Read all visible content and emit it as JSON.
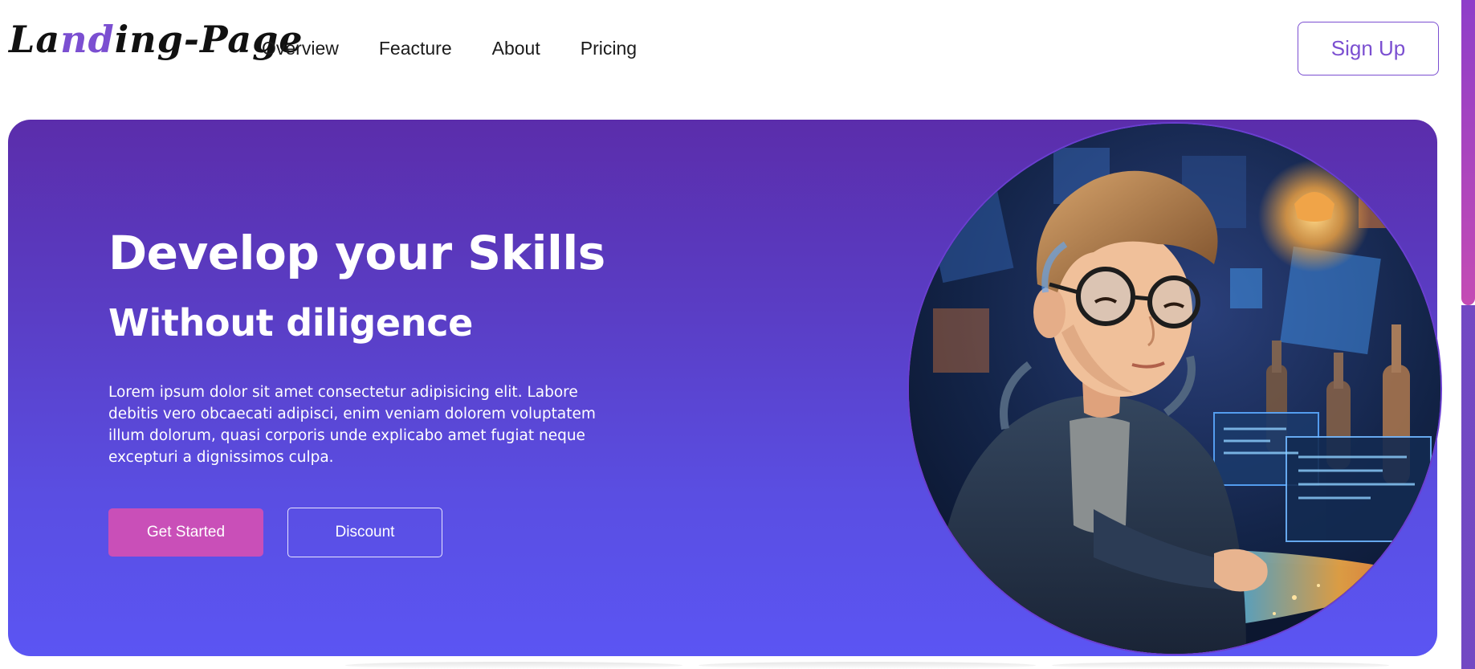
{
  "header": {
    "logo_text_1": "La",
    "logo_text_accent": "nd",
    "logo_text_2": "ing-Page",
    "nav": [
      "Overview",
      "Feacture",
      "About",
      "Pricing"
    ],
    "signup_label": "Sign Up"
  },
  "hero": {
    "headline": "Develop your Skills",
    "subheadline": "Without diligence",
    "description": "Lorem ipsum dolor sit amet consectetur adipisicing elit. Labore debitis vero obcaecati adipisci, enim veniam dolorem voluptatem illum dolorum, quasi corporis unde explicabo amet fugiat neque excepturi a dignissimos culpa.",
    "primary_button": "Get Started",
    "secondary_button": "Discount"
  },
  "colors": {
    "accent": "#7b4fd1",
    "hero_gradient_top": "#5b2dab",
    "hero_gradient_bottom": "#5b55f3",
    "primary_button": "#c94fb8"
  },
  "icons": {
    "hero_image": "boy-with-glasses-at-glowing-desk-illustration"
  }
}
